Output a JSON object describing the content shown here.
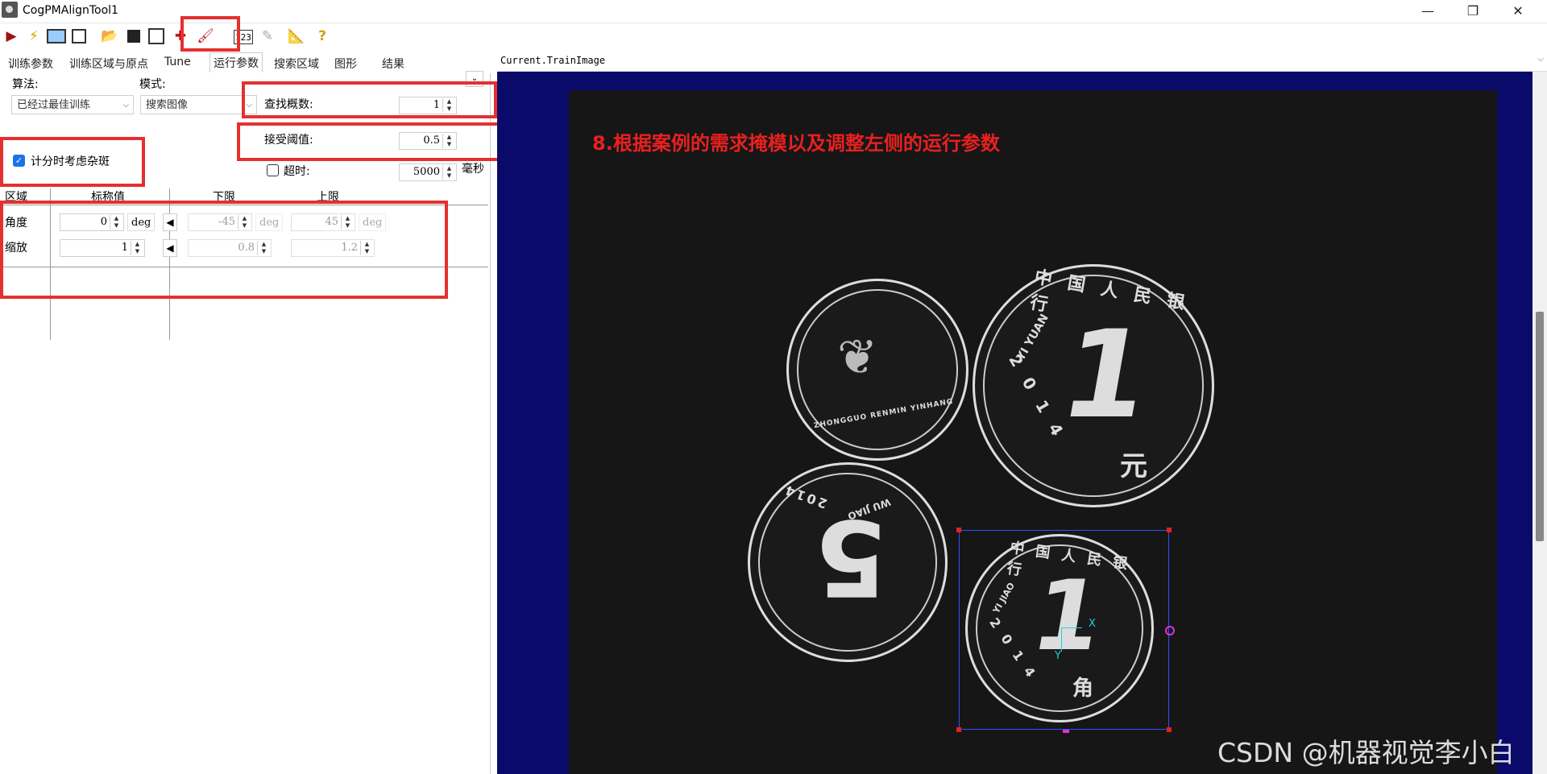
{
  "window": {
    "title": "CogPMAlignTool1",
    "minimize": "—",
    "restore": "❐",
    "close": "✕"
  },
  "toolbar": {
    "icons": [
      "run-icon",
      "electric-run-icon",
      "train-icon",
      "copy-icon",
      "open-icon",
      "save-icon",
      "reset-icon",
      "erase-icon",
      "brush-icon",
      "record-icon",
      "edit-icon",
      "grab-icon",
      "help-icon"
    ]
  },
  "tabs": [
    "训练参数",
    "训练区域与原点",
    "Tune",
    "运行参数",
    "搜索区域",
    "图形",
    "结果"
  ],
  "run_params": {
    "algorithm_label": "算法:",
    "algorithm_value": "已经过最佳训练",
    "mode_label": "模式:",
    "mode_value": "搜索图像",
    "find_count_label": "查找概数:",
    "find_count_value": "1",
    "accept_label": "接受阈值:",
    "accept_value": "0.5",
    "timeout_label": "超时:",
    "timeout_value": "5000",
    "timeout_unit": "毫秒",
    "clutter_label": "计分时考虑杂斑",
    "clutter_checked": true,
    "timeout_checked": false
  },
  "dof_table": {
    "headers": [
      "区域",
      "标称值",
      "下限",
      "上限"
    ],
    "rows": [
      {
        "name": "角度",
        "nominal": "0",
        "unit": "deg",
        "low": "-45",
        "low_unit": "deg",
        "high": "45",
        "high_unit": "deg"
      },
      {
        "name": "缩放",
        "nominal": "1",
        "unit": "",
        "low": "0.8",
        "low_unit": "",
        "high": "1.2",
        "high_unit": ""
      }
    ]
  },
  "viewer": {
    "caption": "Current.TrainImage",
    "annotation": "8.根据案例的需求掩模以及调整左侧的运行参数",
    "watermark": "CSDN @机器视觉李小白",
    "axis_x": "X",
    "axis_y": "Y"
  },
  "coins": {
    "c1": "中 国 人 民 银 行",
    "c1_year": "2 0 1 4",
    "c1_value": "1",
    "c1_unit": "元",
    "c1_pinyin": "YI YUAN",
    "c2": "ZHONGGUO RENMIN YINHANG",
    "c3_value": "5",
    "c3_year": "2014",
    "c3_pinyin": "WU JIAO",
    "c4_value": "1",
    "c4_unit": "角",
    "c4_year": "2 0 1 4",
    "c4_pinyin": "YI JIAO"
  },
  "colors": {
    "highlight": "#e53030",
    "viewer_bg": "#0a0a6a",
    "checkbox": "#1a73e8"
  }
}
